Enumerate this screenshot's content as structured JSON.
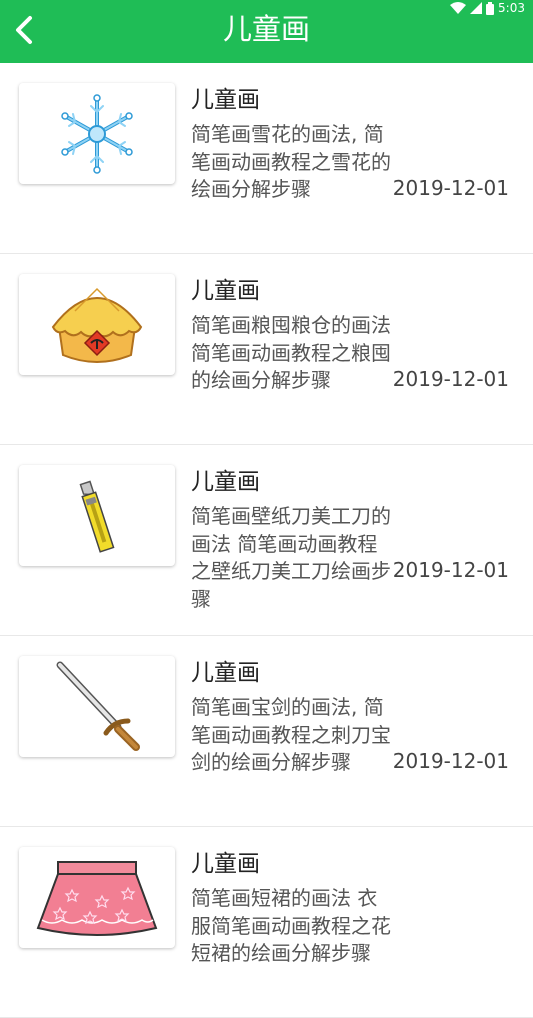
{
  "status_bar": {
    "time": "5:03"
  },
  "header": {
    "title": "儿童画"
  },
  "items": [
    {
      "title": "儿童画",
      "desc": "简笔画雪花的画法, 简笔画动画教程之雪花的绘画分解步骤",
      "date": "2019-12-01",
      "icon": "snowflake"
    },
    {
      "title": "儿童画",
      "desc": "简笔画粮囤粮仓的画法 简笔画动画教程之粮囤的绘画分解步骤",
      "date": "2019-12-01",
      "icon": "granary"
    },
    {
      "title": "儿童画",
      "desc": "简笔画壁纸刀美工刀的画法 简笔画动画教程之壁纸刀美工刀绘画步骤",
      "date": "2019-12-01",
      "icon": "utility-knife"
    },
    {
      "title": "儿童画",
      "desc": "简笔画宝剑的画法, 简笔画动画教程之刺刀宝剑的绘画分解步骤",
      "date": "2019-12-01",
      "icon": "sword"
    },
    {
      "title": "儿童画",
      "desc": "简笔画短裙的画法 衣服简笔画动画教程之花短裙的绘画分解步骤",
      "date": "",
      "icon": "skirt"
    }
  ],
  "colors": {
    "accent": "#1fbd56"
  }
}
